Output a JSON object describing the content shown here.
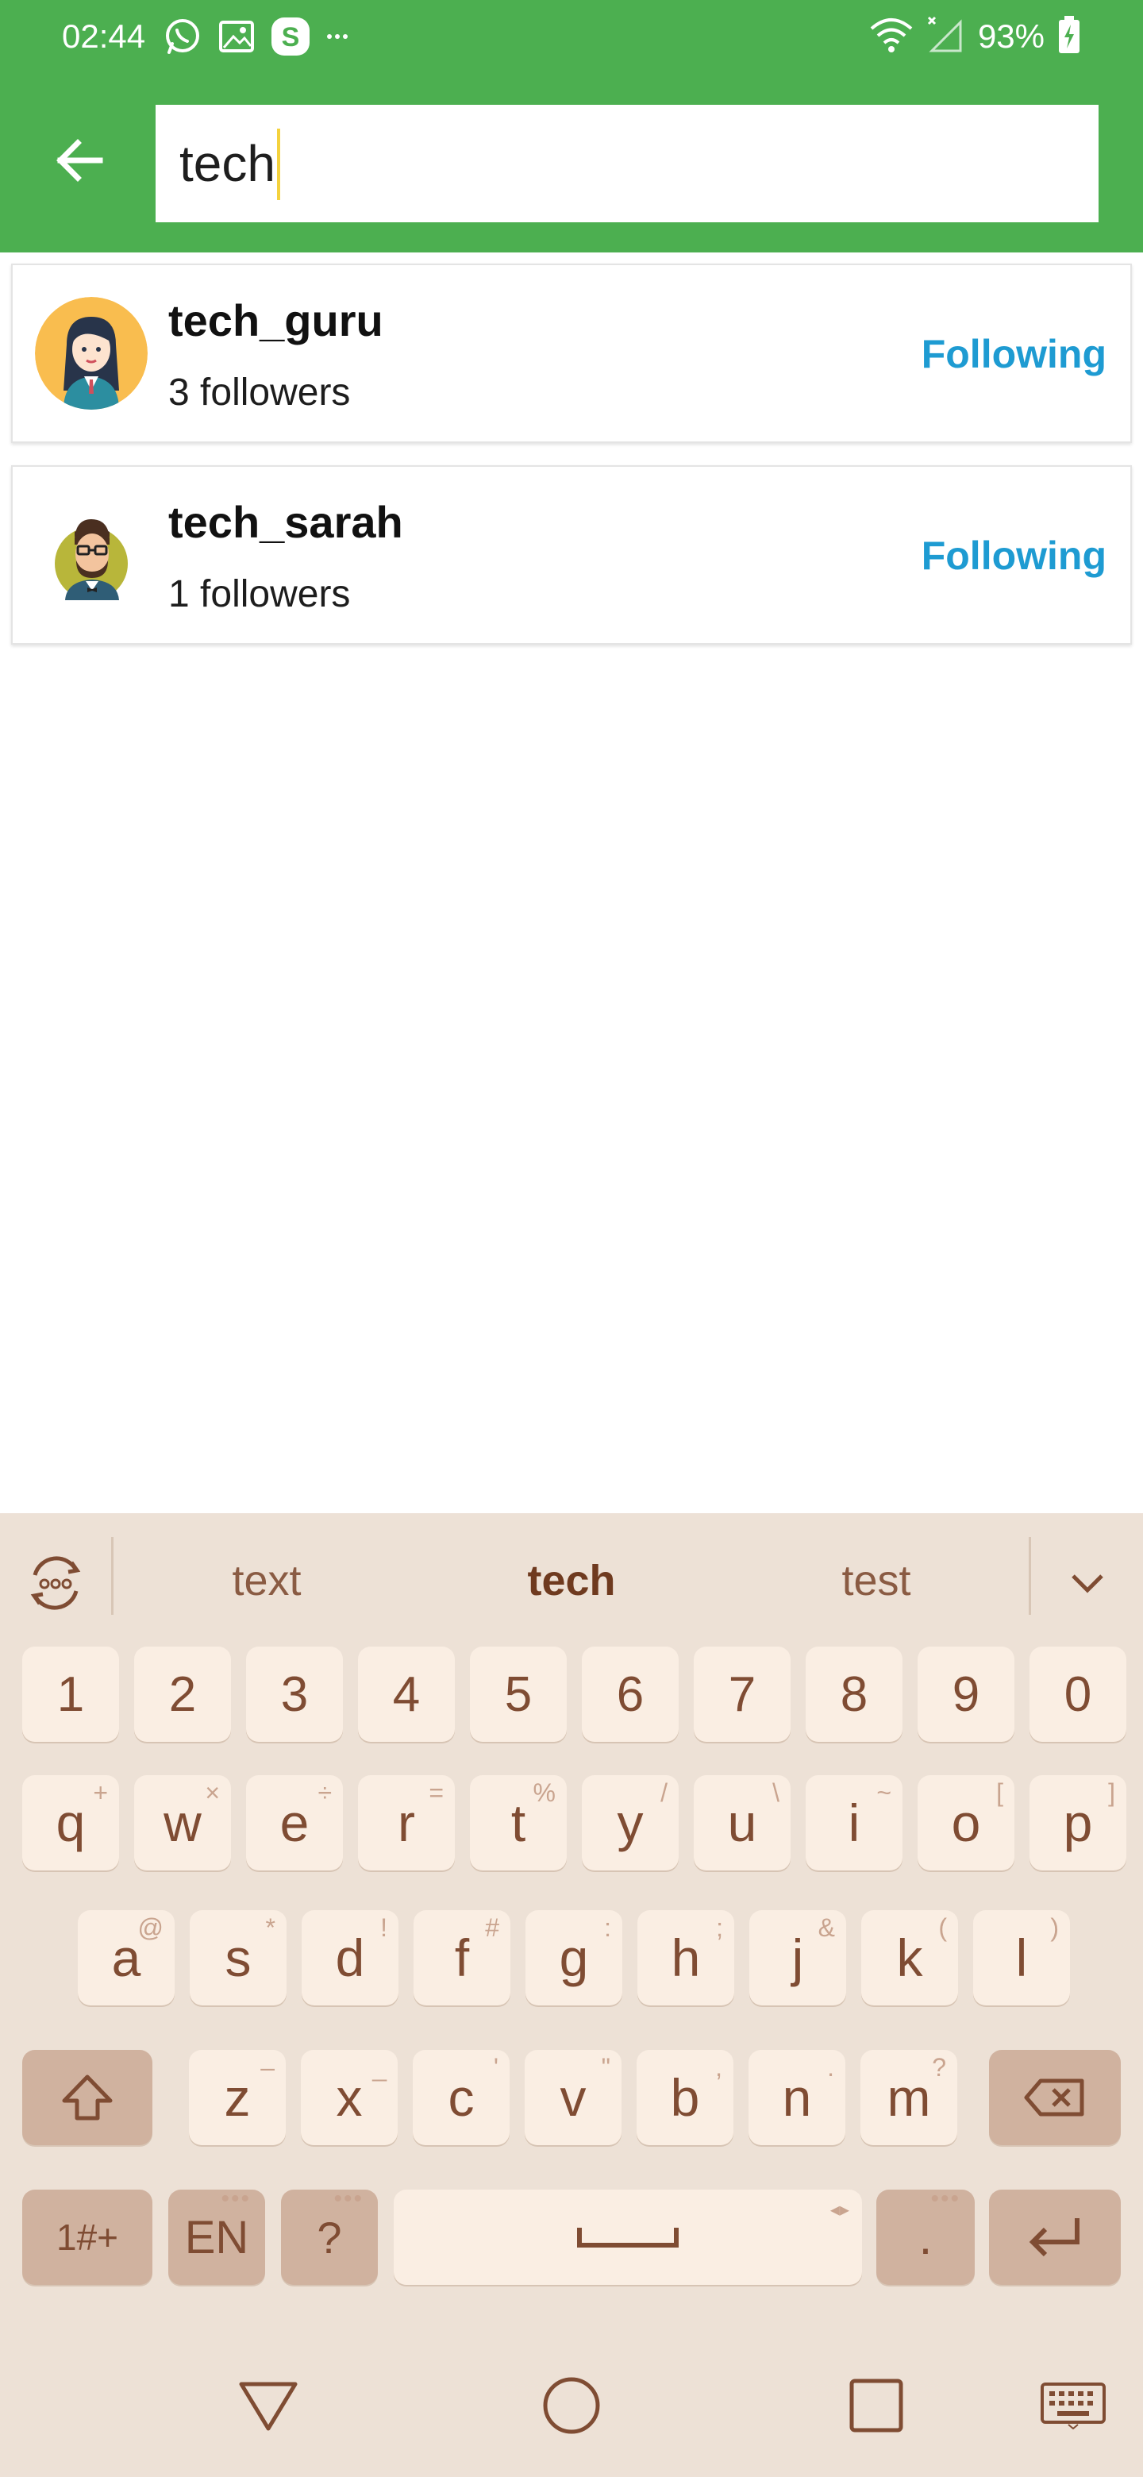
{
  "status_bar": {
    "time": "02:44",
    "battery_percent": "93%",
    "icons_left": [
      "whatsapp-icon",
      "gallery-icon",
      "skype-icon",
      "more-notifications-icon"
    ],
    "icons_right": [
      "wifi-icon",
      "signal-icon",
      "battery-charging-icon"
    ]
  },
  "app_bar": {
    "search_value": "tech",
    "theme_color": "#4caf50"
  },
  "results": [
    {
      "username": "tech_guru",
      "followers": "3 followers",
      "button_label": "Following",
      "avatar": "woman-avatar-icon"
    },
    {
      "username": "tech_sarah",
      "followers": "1 followers",
      "button_label": "Following",
      "avatar": "man-glasses-avatar-icon"
    }
  ],
  "keyboard": {
    "suggestions": [
      "text",
      "tech",
      "test"
    ],
    "number_row": [
      "1",
      "2",
      "3",
      "4",
      "5",
      "6",
      "7",
      "8",
      "9",
      "0"
    ],
    "row_q": [
      {
        "key": "q",
        "hint": "+"
      },
      {
        "key": "w",
        "hint": "×"
      },
      {
        "key": "e",
        "hint": "÷"
      },
      {
        "key": "r",
        "hint": "="
      },
      {
        "key": "t",
        "hint": "%"
      },
      {
        "key": "y",
        "hint": "/"
      },
      {
        "key": "u",
        "hint": "\\"
      },
      {
        "key": "i",
        "hint": "~"
      },
      {
        "key": "o",
        "hint": "["
      },
      {
        "key": "p",
        "hint": "]"
      }
    ],
    "row_a": [
      {
        "key": "a",
        "hint": "@"
      },
      {
        "key": "s",
        "hint": "*"
      },
      {
        "key": "d",
        "hint": "!"
      },
      {
        "key": "f",
        "hint": "#"
      },
      {
        "key": "g",
        "hint": ":"
      },
      {
        "key": "h",
        "hint": ";"
      },
      {
        "key": "j",
        "hint": "&"
      },
      {
        "key": "k",
        "hint": "("
      },
      {
        "key": "l",
        "hint": ")"
      }
    ],
    "row_z": [
      {
        "key": "z",
        "hint": "–"
      },
      {
        "key": "x",
        "hint": "_"
      },
      {
        "key": "c",
        "hint": "'"
      },
      {
        "key": "v",
        "hint": "\""
      },
      {
        "key": "b",
        "hint": ","
      },
      {
        "key": "n",
        "hint": "."
      },
      {
        "key": "m",
        "hint": "?"
      }
    ],
    "symbols_label": "1#+",
    "language_label": "EN",
    "question_label": "?",
    "period_label": ".",
    "key_color": "#faeee3",
    "dark_key_color": "#d0b29f",
    "text_color": "#7f4c33"
  },
  "nav_bar": {
    "buttons": [
      "back-triangle-icon",
      "home-circle-icon",
      "recents-square-icon",
      "keyboard-icon"
    ]
  }
}
